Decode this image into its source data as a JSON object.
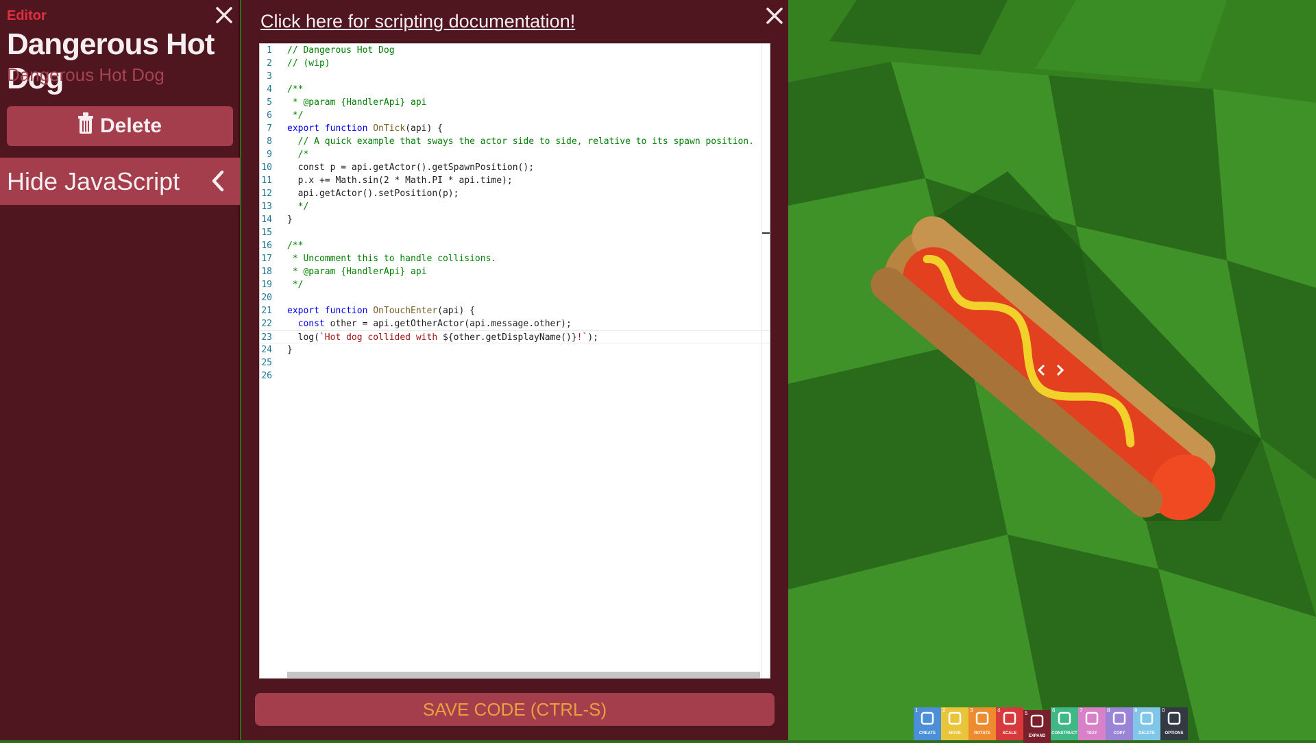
{
  "sidebar": {
    "section_label": "Editor",
    "title": "Dangerous Hot Dog",
    "subtitle": "Dangerous Hot Dog",
    "delete_label": "Delete",
    "hide_js_label": "Hide JavaScript"
  },
  "editor": {
    "doc_link": "Click here for scripting documentation!",
    "save_label": "SAVE CODE (CTRL-S)",
    "active_line": 23,
    "line_numbers": [
      "1",
      "2",
      "3",
      "4",
      "5",
      "6",
      "7",
      "8",
      "9",
      "10",
      "11",
      "12",
      "13",
      "14",
      "15",
      "16",
      "17",
      "18",
      "19",
      "20",
      "21",
      "22",
      "23",
      "24",
      "25",
      "26"
    ],
    "lines": [
      "// Dangerous Hot Dog",
      "// (wip)",
      "",
      "/**",
      " * @param {HandlerApi} api",
      " */",
      "export function OnTick(api) {",
      "  // A quick example that sways the actor side to side, relative to its spawn position.",
      "  /*",
      "  const p = api.getActor().getSpawnPosition();",
      "  p.x += Math.sin(2 * Math.PI * api.time);",
      "  api.getActor().setPosition(p);",
      "  */",
      "}",
      "",
      "/**",
      " * Uncomment this to handle collisions.",
      " * @param {HandlerApi} api",
      " */",
      "",
      "export function OnTouchEnter(api) {",
      "  const other = api.getOtherActor(api.message.other);",
      "  log(`Hot dog collided with ${other.getDisplayName()}!`);",
      "}",
      "",
      ""
    ]
  },
  "toolbar": {
    "tools": [
      {
        "num": "1",
        "label": "CREATE",
        "color": "#4a8fd8",
        "icon": "create-icon"
      },
      {
        "num": "2",
        "label": "MOVE",
        "color": "#e8c53a",
        "icon": "move-icon"
      },
      {
        "num": "3",
        "label": "ROTATE",
        "color": "#ee8b2f",
        "icon": "rotate-icon"
      },
      {
        "num": "4",
        "label": "SCALE",
        "color": "#d8393c",
        "icon": "scale-icon"
      },
      {
        "num": "5",
        "label": "EXPAND",
        "color": "#7a1f2c",
        "icon": "code-icon"
      },
      {
        "num": "6",
        "label": "CONSTRUCT",
        "color": "#3fb885",
        "icon": "construct-icon"
      },
      {
        "num": "7",
        "label": "TEXT",
        "color": "#d880c8",
        "icon": "text-icon"
      },
      {
        "num": "8",
        "label": "COPY",
        "color": "#9a84d8",
        "icon": "copy-icon"
      },
      {
        "num": "9",
        "label": "DELETE",
        "color": "#7fc6e8",
        "icon": "trash-icon"
      },
      {
        "num": "0",
        "label": "OPTIONS",
        "color": "#333a44",
        "icon": "gear-icon"
      }
    ]
  }
}
